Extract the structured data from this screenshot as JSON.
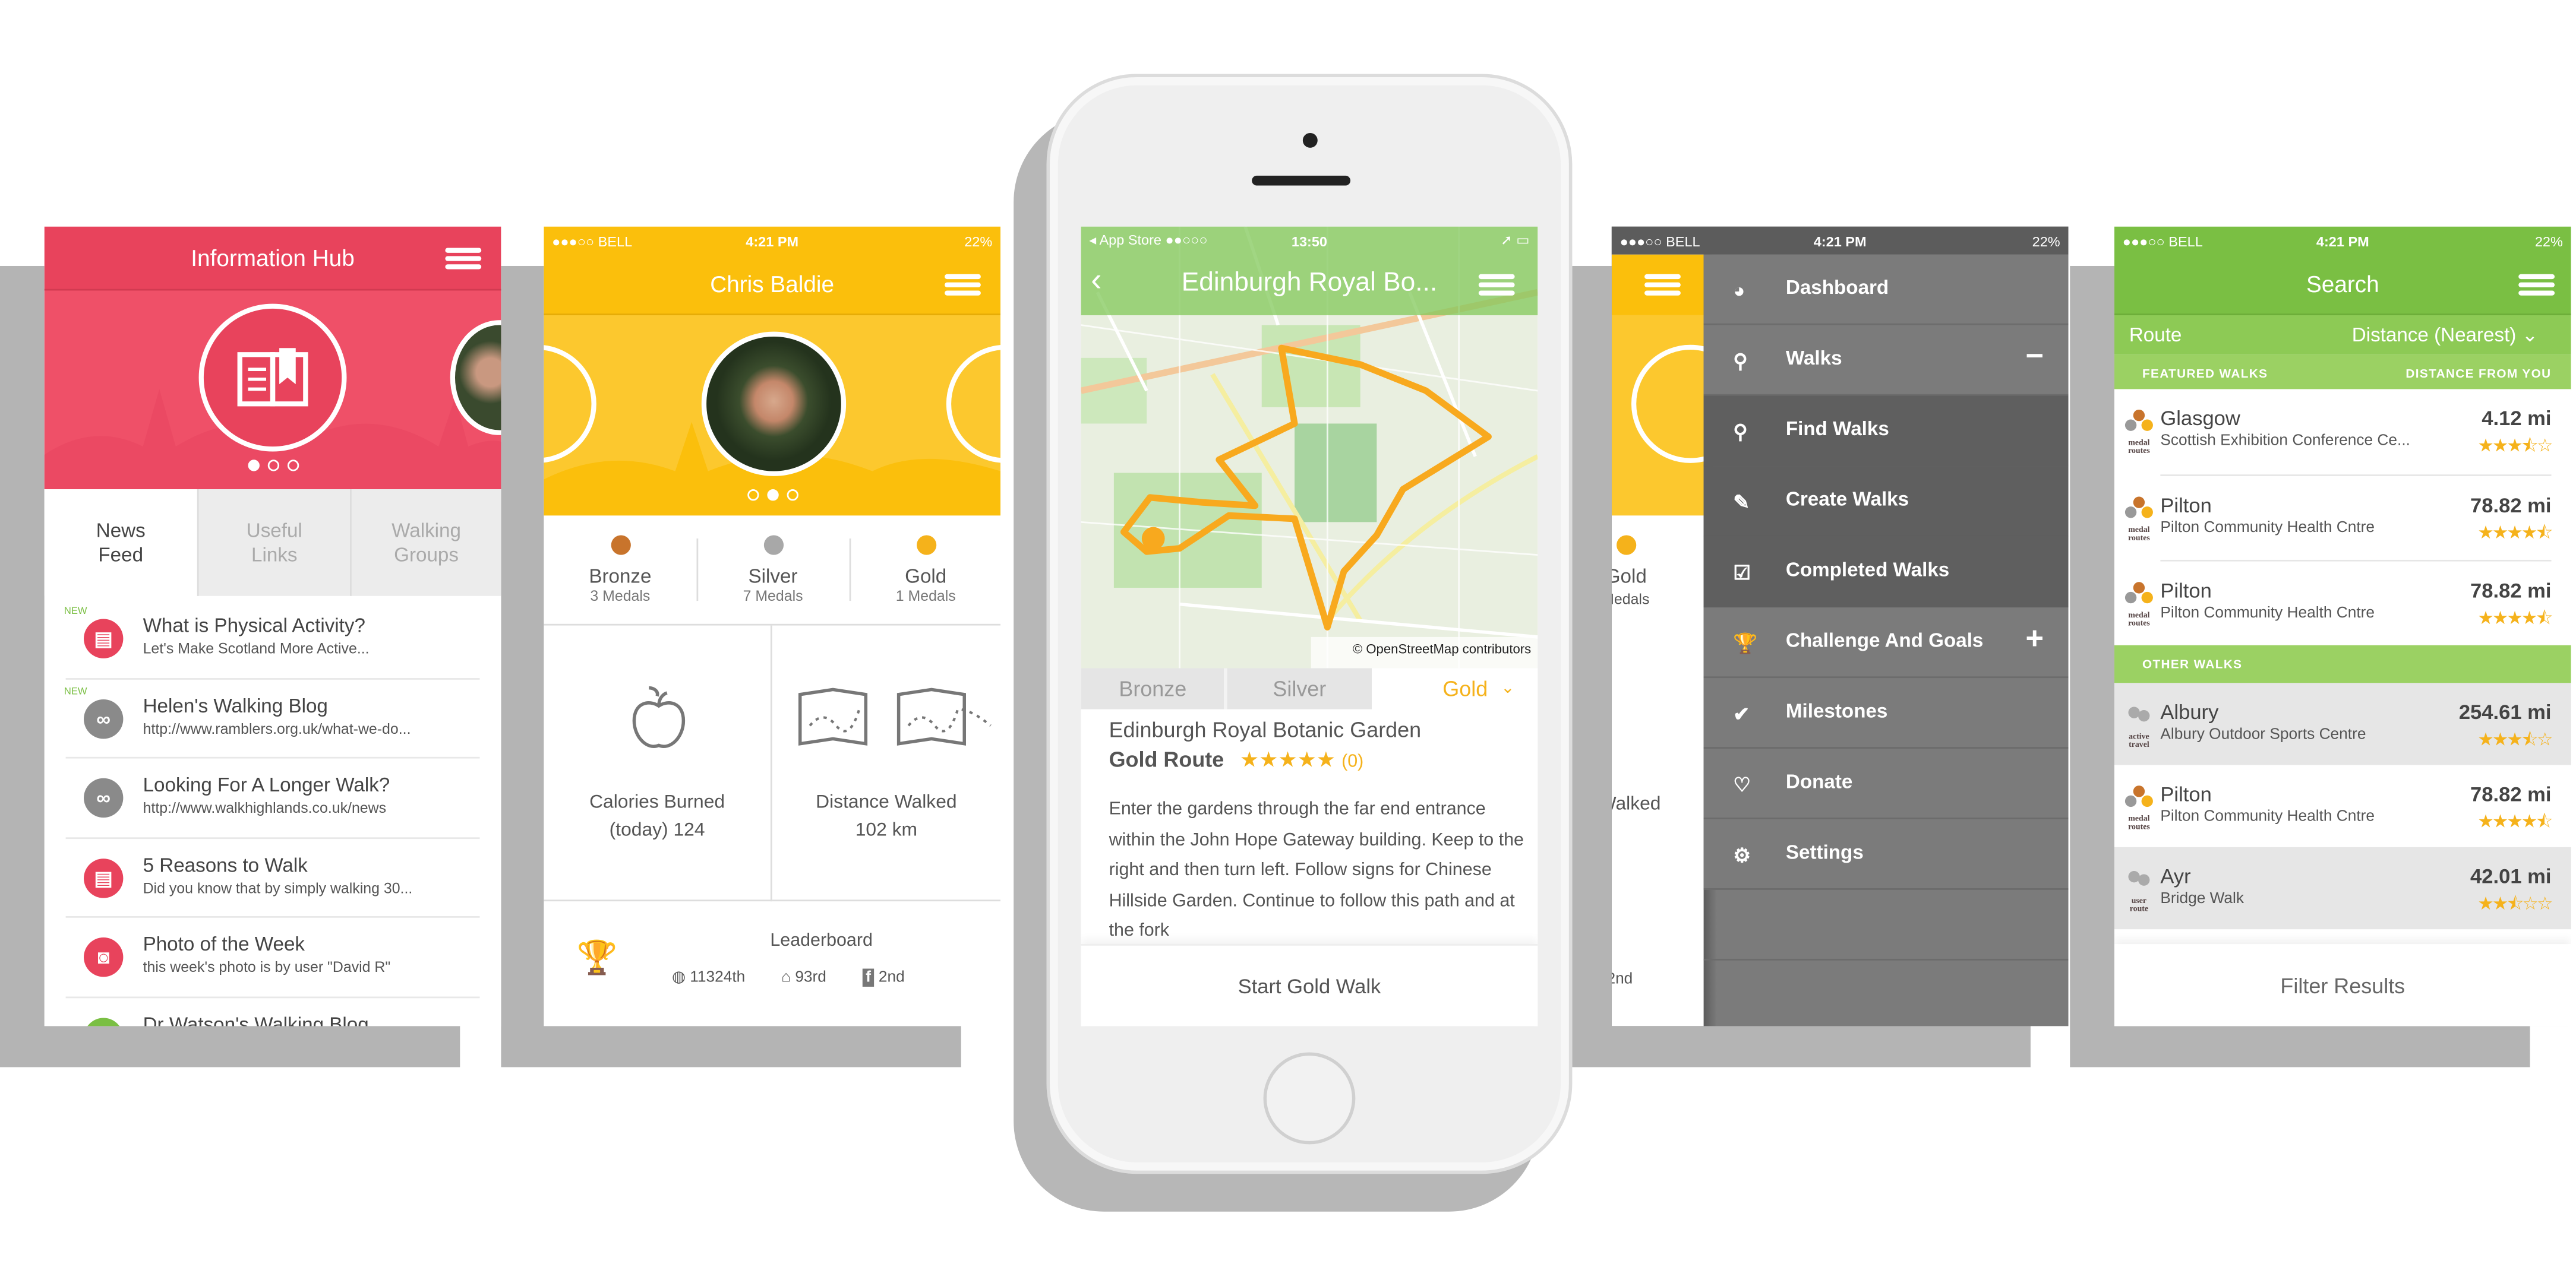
{
  "colors": {
    "pink": "#e8435c",
    "yellow": "#fbbf0c",
    "green": "#7abf43",
    "menu_gray": "#7b7b7b",
    "gold": "#f5b21b",
    "bronze": "#c8742c",
    "silver": "#a8a8a8"
  },
  "status": {
    "carrier": "●●●○○ BELL",
    "time": "4:21 PM",
    "battery": "22%"
  },
  "info_hub": {
    "title": "Information Hub",
    "tabs": [
      {
        "label": "News\nFeed",
        "active": true
      },
      {
        "label": "Useful\nLinks"
      },
      {
        "label": "Walking\nGroups"
      }
    ],
    "items": [
      {
        "title": "What is Physical Activity?",
        "sub": "Let's Make Scotland More Active...",
        "icon": "document-icon",
        "badge": "NEW",
        "color": "#e8435c"
      },
      {
        "title": "Helen's Walking Blog",
        "sub": "http://www.ramblers.org.uk/what-we-do...",
        "icon": "link-icon",
        "badge": "NEW",
        "color": "#8a8a8a"
      },
      {
        "title": "Looking For A Longer Walk?",
        "sub": "http://www.walkhighlands.co.uk/news",
        "icon": "link-icon",
        "color": "#8a8a8a"
      },
      {
        "title": "5 Reasons to Walk",
        "sub": "Did you know that by simply walking 30...",
        "icon": "document-icon",
        "color": "#e8435c"
      },
      {
        "title": "Photo of the Week",
        "sub": "this week's photo is by user \"David R\"",
        "icon": "camera-icon",
        "color": "#e8435c"
      },
      {
        "title": "Dr Watson's Walking Blog",
        "sub": "",
        "icon": "link-icon",
        "color": "#7abf43"
      }
    ]
  },
  "profile": {
    "name": "Chris Baldie",
    "medals": [
      {
        "label": "Bronze",
        "count": "3 Medals"
      },
      {
        "label": "Silver",
        "count": "7 Medals"
      },
      {
        "label": "Gold",
        "count": "1 Medals"
      }
    ],
    "calories_label": "Calories Burned",
    "calories_value": "(today) 124",
    "distance_label": "Distance Walked",
    "distance_value": "102 km",
    "leaderboard": {
      "label": "Leaderboard",
      "global": "11324th",
      "local": "93rd",
      "facebook": "2nd"
    }
  },
  "walk": {
    "status_left": "App Store",
    "status_time": "13:50",
    "header_title": "Edinburgh Royal Bo...",
    "attribution": "© OpenStreetMap contributors",
    "tabs": [
      "Bronze",
      "Silver",
      "Gold"
    ],
    "selected_tab": "Gold",
    "title": "Edinburgh Royal Botanic Garden",
    "route": "Gold Route",
    "rating": 5,
    "stars": "★★★★★",
    "reviews": "(0)",
    "description": "Enter the gardens through the far end entrance within the John Hope Gateway building. Keep to the right and then turn left. Follow signs for Chinese Hillside Garden. Continue to follow this path and at the fork",
    "start_button": "Start Gold Walk"
  },
  "menu": {
    "behind": {
      "medal": "Gold",
      "medal_sub": "Medals",
      "stat": "Walked",
      "rank": "2nd"
    },
    "items": [
      {
        "label": "Dashboard",
        "icon": "dashboard-icon",
        "glyph": "◕"
      },
      {
        "label": "Walks",
        "icon": "search-icon",
        "glyph": "⚲",
        "sign": "−",
        "expanded": true
      },
      {
        "label": "Find Walks",
        "icon": "search-icon",
        "glyph": "⚲",
        "sub": true
      },
      {
        "label": "Create Walks",
        "icon": "pencil-icon",
        "glyph": "✎",
        "sub": true
      },
      {
        "label": "Completed Walks",
        "icon": "checkbox-icon",
        "glyph": "☑",
        "sub": true
      },
      {
        "label": "Challenge And Goals",
        "icon": "trophy-icon",
        "glyph": "🏆",
        "sign": "+"
      },
      {
        "label": "Milestones",
        "icon": "check-icon",
        "glyph": "✔"
      },
      {
        "label": "Donate",
        "icon": "heart-icon",
        "glyph": "♡"
      },
      {
        "label": "Settings",
        "icon": "gears-icon",
        "glyph": "⚙"
      }
    ]
  },
  "search": {
    "title": "Search",
    "sort_left": "Route",
    "sort_right": "Distance (Nearest) ⌄",
    "featured_label": "FEATURED WALKS",
    "distance_label": "DISTANCE FROM YOU",
    "other_label": "OTHER WALKS",
    "featured": [
      {
        "name": "Glasgow",
        "place": "Scottish Exhibition Conference Ce...",
        "distance": "4.12 mi",
        "rating": 3.5,
        "type": "medal routes"
      },
      {
        "name": "Pilton",
        "place": "Pilton Community Health Cntre",
        "distance": "78.82 mi",
        "rating": 4.5,
        "type": "medal routes"
      },
      {
        "name": "Pilton",
        "place": "Pilton Community Health Cntre",
        "distance": "78.82 mi",
        "rating": 4.5,
        "type": "medal routes"
      }
    ],
    "other": [
      {
        "name": "Albury",
        "place": "Albury Outdoor Sports Centre",
        "distance": "254.61 mi",
        "rating": 3.5,
        "type": "active travel",
        "shaded": true
      },
      {
        "name": "Pilton",
        "place": "Pilton Community Health Cntre",
        "distance": "78.82 mi",
        "rating": 4.5,
        "type": "medal routes"
      },
      {
        "name": "Ayr",
        "place": "Bridge Walk",
        "distance": "42.01 mi",
        "rating": 2.5,
        "type": "user route",
        "shaded": true
      }
    ],
    "filter_button": "Filter Results"
  }
}
